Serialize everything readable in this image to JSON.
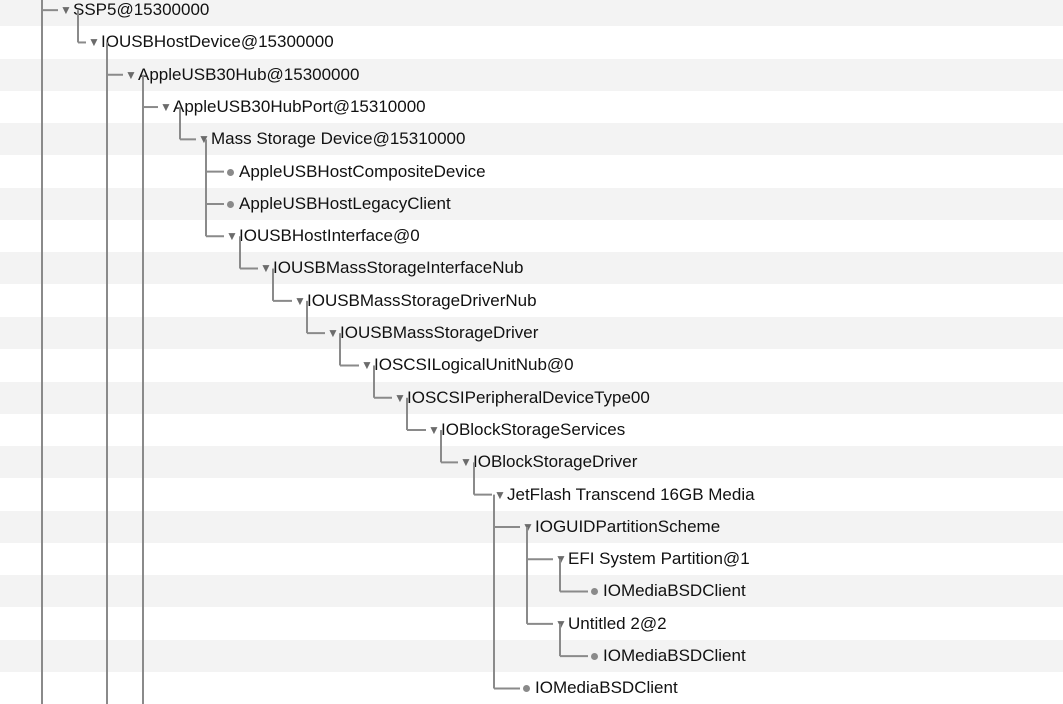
{
  "tree": {
    "rows": [
      {
        "label": "SSP5@15300000",
        "expanded": true
      },
      {
        "label": "IOUSBHostDevice@15300000",
        "expanded": true
      },
      {
        "label": "AppleUSB30Hub@15300000",
        "expanded": true
      },
      {
        "label": "AppleUSB30HubPort@15310000",
        "expanded": true
      },
      {
        "label": "Mass Storage Device@15310000",
        "expanded": true
      },
      {
        "label": "AppleUSBHostCompositeDevice",
        "expanded": null
      },
      {
        "label": "AppleUSBHostLegacyClient",
        "expanded": null
      },
      {
        "label": "IOUSBHostInterface@0",
        "expanded": true
      },
      {
        "label": "IOUSBMassStorageInterfaceNub",
        "expanded": true
      },
      {
        "label": "IOUSBMassStorageDriverNub",
        "expanded": true
      },
      {
        "label": "IOUSBMassStorageDriver",
        "expanded": true
      },
      {
        "label": "IOSCSILogicalUnitNub@0",
        "expanded": true
      },
      {
        "label": "IOSCSIPeripheralDeviceType00",
        "expanded": true
      },
      {
        "label": "IOBlockStorageServices",
        "expanded": true
      },
      {
        "label": "IOBlockStorageDriver",
        "expanded": true
      },
      {
        "label": "JetFlash Transcend 16GB Media",
        "expanded": true
      },
      {
        "label": "IOGUIDPartitionScheme",
        "expanded": true
      },
      {
        "label": "EFI System Partition@1",
        "expanded": true
      },
      {
        "label": "IOMediaBSDClient",
        "expanded": null
      },
      {
        "label": "Untitled 2@2",
        "expanded": true
      },
      {
        "label": "IOMediaBSDClient",
        "expanded": null
      },
      {
        "label": "IOMediaBSDClient",
        "expanded": null
      }
    ]
  },
  "colors": {
    "alt_row": "#f3f3f3",
    "connector": "#8a8a8a",
    "disclosure": "#6b6b6b",
    "text": "#111111"
  },
  "icons": {
    "expanded": "disclosure-triangle-down-icon",
    "leaf": "leaf-dot-icon"
  }
}
